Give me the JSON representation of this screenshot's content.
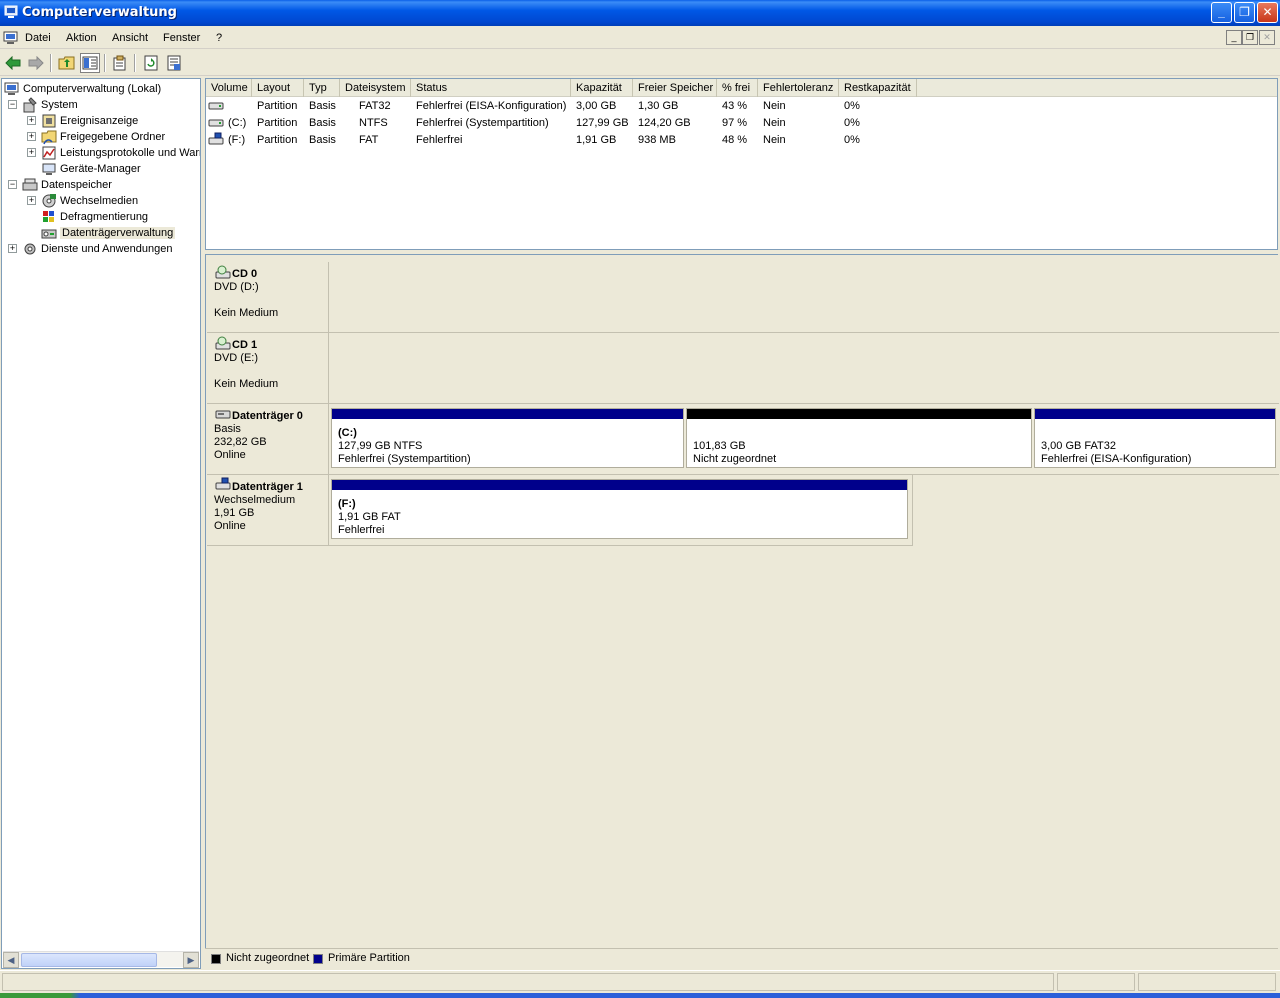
{
  "window": {
    "title": "Computerverwaltung"
  },
  "menu": {
    "items": [
      "Datei",
      "Aktion",
      "Ansicht",
      "Fenster",
      "?"
    ]
  },
  "toolbar": {
    "icons": [
      "back-arrow-icon",
      "forward-arrow-icon",
      "up-folder-icon",
      "show-tree-icon",
      "properties-icon",
      "refresh-icon",
      "export-list-icon"
    ]
  },
  "tree": {
    "root": "Computerverwaltung (Lokal)",
    "system": "System",
    "ereignisanzeige": "Ereignisanzeige",
    "freigegebene_ordner": "Freigegebene Ordner",
    "leistungsprotokolle": "Leistungsprotokolle und Warn",
    "geraete_manager": "Geräte-Manager",
    "datenspeicher": "Datenspeicher",
    "wechselmedien": "Wechselmedien",
    "defragmentierung": "Defragmentierung",
    "datentraegerverwaltung": "Datenträgerverwaltung",
    "dienste": "Dienste und Anwendungen"
  },
  "volumes": {
    "columns": [
      "Volume",
      "Layout",
      "Typ",
      "Dateisystem",
      "Status",
      "Kapazität",
      "Freier Speicher",
      "% frei",
      "Fehlertoleranz",
      "Restkapazität"
    ],
    "rows": [
      {
        "volume": "",
        "layout": "Partition",
        "typ": "Basis",
        "fs": "FAT32",
        "status": "Fehlerfrei (EISA-Konfiguration)",
        "cap": "3,00 GB",
        "free": "1,30 GB",
        "pct": "43 %",
        "ft": "Nein",
        "rest": "0%"
      },
      {
        "volume": "(C:)",
        "layout": "Partition",
        "typ": "Basis",
        "fs": "NTFS",
        "status": "Fehlerfrei (Systempartition)",
        "cap": "127,99 GB",
        "free": "124,20 GB",
        "pct": "97 %",
        "ft": "Nein",
        "rest": "0%"
      },
      {
        "volume": "(F:)",
        "layout": "Partition",
        "typ": "Basis",
        "fs": "FAT",
        "status": "Fehlerfrei",
        "cap": "1,91 GB",
        "free": "938 MB",
        "pct": "48 %",
        "ft": "Nein",
        "rest": "0%"
      }
    ]
  },
  "disks": {
    "cd0": {
      "name": "CD 0",
      "line2": "DVD (D:)",
      "line4": "Kein Medium"
    },
    "cd1": {
      "name": "CD 1",
      "line2": "DVD (E:)",
      "line4": "Kein Medium"
    },
    "disk0": {
      "name": "Datenträger 0",
      "line2": "Basis",
      "line3": "232,82 GB",
      "line4": "Online",
      "partitions": [
        {
          "title": "(C:)",
          "size": "127,99 GB NTFS",
          "status": "Fehlerfrei (Systempartition)"
        },
        {
          "title": "",
          "size": "101,83 GB",
          "status": "Nicht zugeordnet"
        },
        {
          "title": "",
          "size": "3,00 GB FAT32",
          "status": "Fehlerfrei (EISA-Konfiguration)"
        }
      ]
    },
    "disk1": {
      "name": "Datenträger 1",
      "line2": "Wechselmedium",
      "line3": "1,91 GB",
      "line4": "Online",
      "partitions": [
        {
          "title": "(F:)",
          "size": "1,91 GB FAT",
          "status": "Fehlerfrei"
        }
      ]
    }
  },
  "legend": {
    "unallocated": "Nicht zugeordnet",
    "primary": "Primäre Partition"
  },
  "colors": {
    "primary": "#00008b",
    "unallocated": "#000000",
    "titlebar": "#0054e3"
  }
}
